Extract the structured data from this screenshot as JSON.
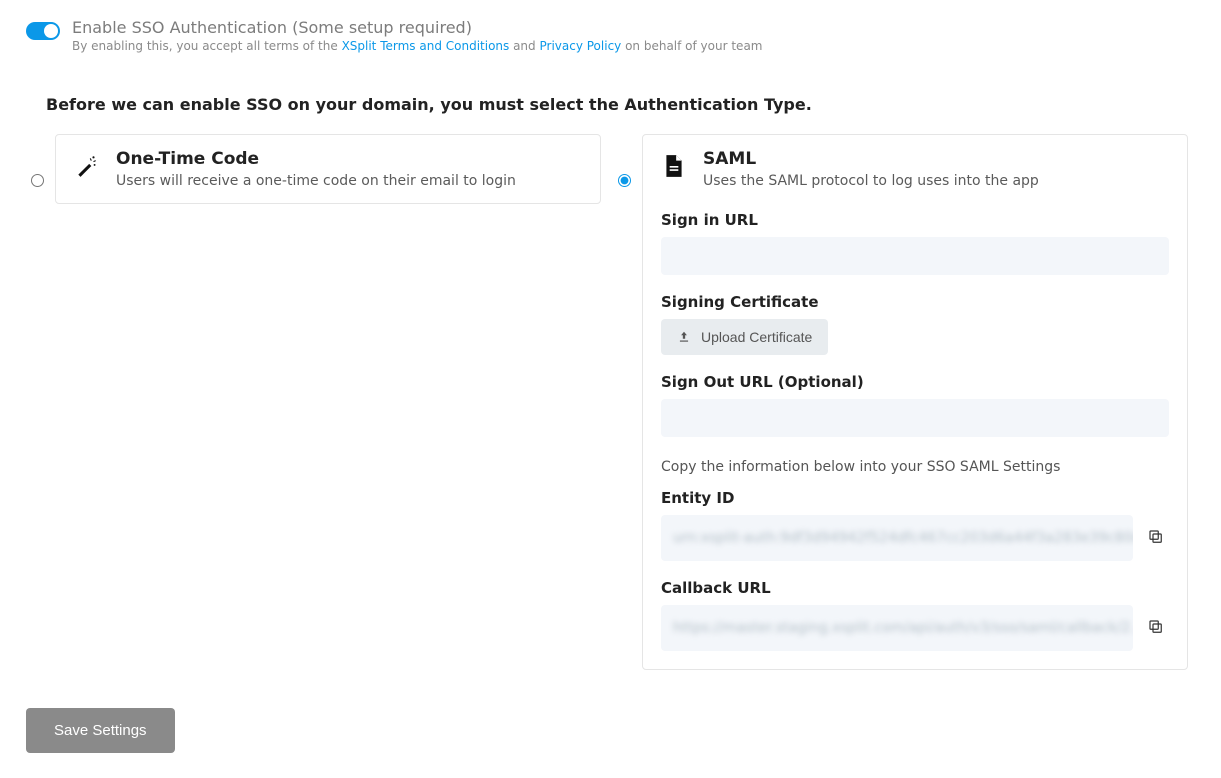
{
  "toggle": {
    "title": "Enable SSO Authentication (Some setup required)",
    "sub_prefix": "By enabling this, you accept all terms of the ",
    "link1": "XSplit Terms and Conditions",
    "sub_mid": " and ",
    "link2": "Privacy Policy",
    "sub_suffix": " on behalf of your team"
  },
  "heading": "Before we can enable SSO on your domain, you must select the Authentication Type.",
  "otc": {
    "title": "One-Time Code",
    "desc": "Users will receive a one-time code on their email to login"
  },
  "saml": {
    "title": "SAML",
    "desc": "Uses the SAML protocol to log uses into the app",
    "signin_label": "Sign in URL",
    "signin_value": "",
    "signing_label": "Signing Certificate",
    "upload_label": "Upload Certificate",
    "signout_label": "Sign Out URL (Optional)",
    "signout_value": "",
    "info_text": "Copy the information below into your SSO SAML Settings",
    "entity_label": "Entity ID",
    "entity_value": "urn:xsplit-auth:9df3d94942f524dfc467cc203d6a44f3a283e39c80d...",
    "callback_label": "Callback URL",
    "callback_value": "https://master.staging.xsplit.com/api/auth/v3/sso/saml/callback/2..."
  },
  "save_label": "Save Settings"
}
